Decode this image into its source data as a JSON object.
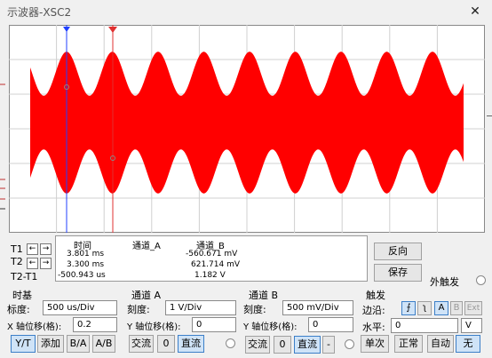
{
  "window": {
    "title": "示波器-XSC2",
    "close_icon": "close-icon"
  },
  "readout": {
    "rows": [
      "T1",
      "T2",
      "T2-T1"
    ],
    "headers": {
      "time": "时间",
      "ch_a": "通道_A",
      "ch_b": "通道_B"
    },
    "t1": {
      "time": "3.801 ms",
      "ch_a": "",
      "ch_b": "-560.671 mV"
    },
    "t2": {
      "time": "3.300 ms",
      "ch_a": "",
      "ch_b": "621.714 mV"
    },
    "dt": {
      "time": "-500.943 us",
      "ch_a": "",
      "ch_b": "1.182 V"
    }
  },
  "buttons": {
    "reverse": "反向",
    "save": "保存",
    "ext_trigger": "外触发"
  },
  "timebase": {
    "title": "时基",
    "scale_label": "标度:",
    "scale_value": "500 us/Div",
    "xpos_label": "X 轴位移(格):",
    "xpos_value": "0.2",
    "modes": [
      "Y/T",
      "添加",
      "B/A",
      "A/B"
    ]
  },
  "channel_a": {
    "title": "通道 A",
    "scale_label": "刻度:",
    "scale_value": "1  V/Div",
    "ypos_label": "Y 轴位移(格):",
    "ypos_value": "0",
    "coupling": [
      "交流",
      "0",
      "直流"
    ]
  },
  "channel_b": {
    "title": "通道 B",
    "scale_label": "刻度:",
    "scale_value": "500 mV/Div",
    "ypos_label": "Y 轴位移(格):",
    "ypos_value": "0",
    "coupling": [
      "交流",
      "0",
      "直流",
      "-"
    ]
  },
  "trigger": {
    "title": "触发",
    "edge_label": "边沿:",
    "edge_buttons": [
      "A",
      "B",
      "Ext"
    ],
    "level_label": "水平:",
    "level_value": "0",
    "level_unit": "V",
    "modes": [
      "单次",
      "正常",
      "自动",
      "无"
    ]
  },
  "colors": {
    "trace": "#ff0000",
    "cursor1": "#2040ff",
    "cursor2": "#e03030"
  }
}
